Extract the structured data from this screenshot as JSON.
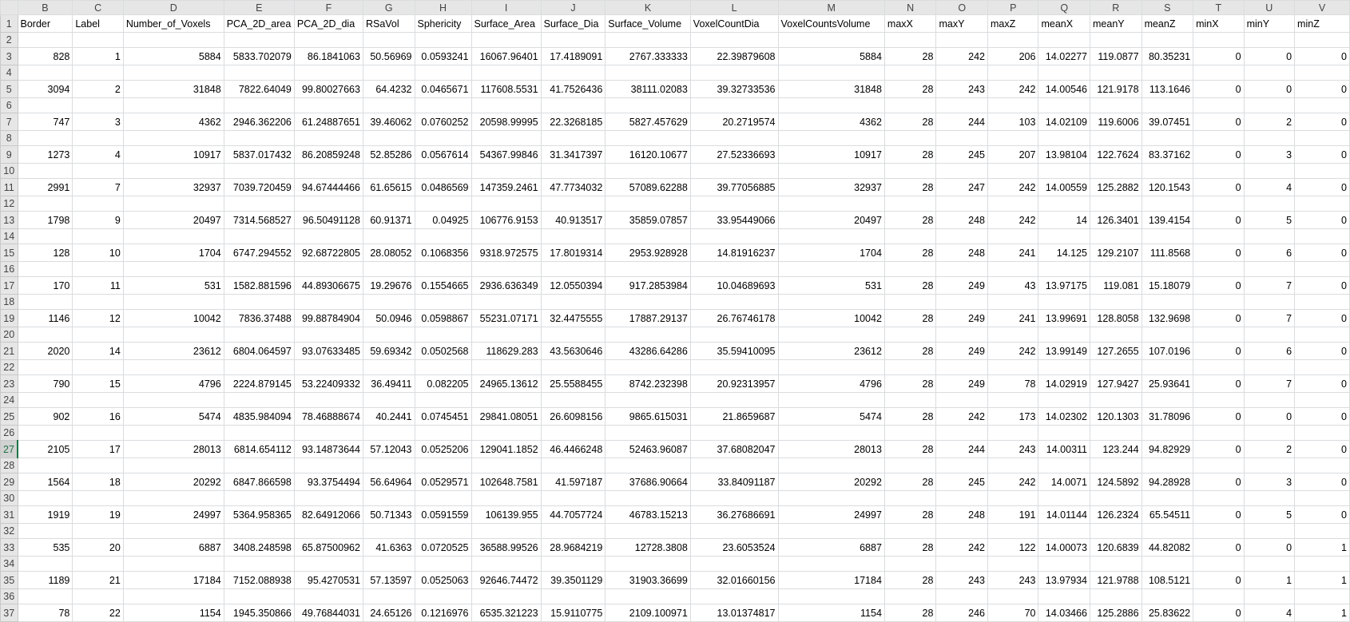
{
  "columns": [
    "B",
    "C",
    "D",
    "E",
    "F",
    "G",
    "H",
    "I",
    "J",
    "K",
    "L",
    "M",
    "N",
    "O",
    "P",
    "Q",
    "R",
    "S",
    "T",
    "U",
    "V"
  ],
  "header_row_num": "1",
  "headers": [
    "Border",
    "Label",
    "Number_of_Voxels",
    "PCA_2D_area",
    "PCA_2D_dia",
    "RSaVol",
    "Sphericity",
    "Surface_Area",
    "Surface_Dia",
    "Surface_Volume",
    "VoxelCountDia",
    "VoxelCountsVolume",
    "maxX",
    "maxY",
    "maxZ",
    "meanX",
    "meanY",
    "meanZ",
    "minX",
    "minY",
    "minZ"
  ],
  "active_row": "27",
  "rows": [
    {
      "num": "2",
      "cells": []
    },
    {
      "num": "3",
      "cells": [
        "828",
        "1",
        "5884",
        "5833.702079",
        "86.1841063",
        "50.56969",
        "0.0593241",
        "16067.96401",
        "17.4189091",
        "2767.333333",
        "22.39879608",
        "5884",
        "28",
        "242",
        "206",
        "14.02277",
        "119.0877",
        "80.35231",
        "0",
        "0",
        "0"
      ]
    },
    {
      "num": "4",
      "cells": []
    },
    {
      "num": "5",
      "cells": [
        "3094",
        "2",
        "31848",
        "7822.64049",
        "99.80027663",
        "64.4232",
        "0.0465671",
        "117608.5531",
        "41.7526436",
        "38111.02083",
        "39.32733536",
        "31848",
        "28",
        "243",
        "242",
        "14.00546",
        "121.9178",
        "113.1646",
        "0",
        "0",
        "0"
      ]
    },
    {
      "num": "6",
      "cells": []
    },
    {
      "num": "7",
      "cells": [
        "747",
        "3",
        "4362",
        "2946.362206",
        "61.24887651",
        "39.46062",
        "0.0760252",
        "20598.99995",
        "22.3268185",
        "5827.457629",
        "20.2719574",
        "4362",
        "28",
        "244",
        "103",
        "14.02109",
        "119.6006",
        "39.07451",
        "0",
        "2",
        "0"
      ]
    },
    {
      "num": "8",
      "cells": []
    },
    {
      "num": "9",
      "cells": [
        "1273",
        "4",
        "10917",
        "5837.017432",
        "86.20859248",
        "52.85286",
        "0.0567614",
        "54367.99846",
        "31.3417397",
        "16120.10677",
        "27.52336693",
        "10917",
        "28",
        "245",
        "207",
        "13.98104",
        "122.7624",
        "83.37162",
        "0",
        "3",
        "0"
      ]
    },
    {
      "num": "10",
      "cells": []
    },
    {
      "num": "11",
      "cells": [
        "2991",
        "7",
        "32937",
        "7039.720459",
        "94.67444466",
        "61.65615",
        "0.0486569",
        "147359.2461",
        "47.7734032",
        "57089.62288",
        "39.77056885",
        "32937",
        "28",
        "247",
        "242",
        "14.00559",
        "125.2882",
        "120.1543",
        "0",
        "4",
        "0"
      ]
    },
    {
      "num": "12",
      "cells": []
    },
    {
      "num": "13",
      "cells": [
        "1798",
        "9",
        "20497",
        "7314.568527",
        "96.50491128",
        "60.91371",
        "0.04925",
        "106776.9153",
        "40.913517",
        "35859.07857",
        "33.95449066",
        "20497",
        "28",
        "248",
        "242",
        "14",
        "126.3401",
        "139.4154",
        "0",
        "5",
        "0"
      ]
    },
    {
      "num": "14",
      "cells": []
    },
    {
      "num": "15",
      "cells": [
        "128",
        "10",
        "1704",
        "6747.294552",
        "92.68722805",
        "28.08052",
        "0.1068356",
        "9318.972575",
        "17.8019314",
        "2953.928928",
        "14.81916237",
        "1704",
        "28",
        "248",
        "241",
        "14.125",
        "129.2107",
        "111.8568",
        "0",
        "6",
        "0"
      ]
    },
    {
      "num": "16",
      "cells": []
    },
    {
      "num": "17",
      "cells": [
        "170",
        "11",
        "531",
        "1582.881596",
        "44.89306675",
        "19.29676",
        "0.1554665",
        "2936.636349",
        "12.0550394",
        "917.2853984",
        "10.04689693",
        "531",
        "28",
        "249",
        "43",
        "13.97175",
        "119.081",
        "15.18079",
        "0",
        "7",
        "0"
      ]
    },
    {
      "num": "18",
      "cells": []
    },
    {
      "num": "19",
      "cells": [
        "1146",
        "12",
        "10042",
        "7836.37488",
        "99.88784904",
        "50.0946",
        "0.0598867",
        "55231.07171",
        "32.4475555",
        "17887.29137",
        "26.76746178",
        "10042",
        "28",
        "249",
        "241",
        "13.99691",
        "128.8058",
        "132.9698",
        "0",
        "7",
        "0"
      ]
    },
    {
      "num": "20",
      "cells": []
    },
    {
      "num": "21",
      "cells": [
        "2020",
        "14",
        "23612",
        "6804.064597",
        "93.07633485",
        "59.69342",
        "0.0502568",
        "118629.283",
        "43.5630646",
        "43286.64286",
        "35.59410095",
        "23612",
        "28",
        "249",
        "242",
        "13.99149",
        "127.2655",
        "107.0196",
        "0",
        "6",
        "0"
      ]
    },
    {
      "num": "22",
      "cells": []
    },
    {
      "num": "23",
      "cells": [
        "790",
        "15",
        "4796",
        "2224.879145",
        "53.22409332",
        "36.49411",
        "0.082205",
        "24965.13612",
        "25.5588455",
        "8742.232398",
        "20.92313957",
        "4796",
        "28",
        "249",
        "78",
        "14.02919",
        "127.9427",
        "25.93641",
        "0",
        "7",
        "0"
      ]
    },
    {
      "num": "24",
      "cells": []
    },
    {
      "num": "25",
      "cells": [
        "902",
        "16",
        "5474",
        "4835.984094",
        "78.46888674",
        "40.2441",
        "0.0745451",
        "29841.08051",
        "26.6098156",
        "9865.615031",
        "21.8659687",
        "5474",
        "28",
        "242",
        "173",
        "14.02302",
        "120.1303",
        "31.78096",
        "0",
        "0",
        "0"
      ]
    },
    {
      "num": "26",
      "cells": []
    },
    {
      "num": "27",
      "cells": [
        "2105",
        "17",
        "28013",
        "6814.654112",
        "93.14873644",
        "57.12043",
        "0.0525206",
        "129041.1852",
        "46.4466248",
        "52463.96087",
        "37.68082047",
        "28013",
        "28",
        "244",
        "243",
        "14.00311",
        "123.244",
        "94.82929",
        "0",
        "2",
        "0"
      ]
    },
    {
      "num": "28",
      "cells": []
    },
    {
      "num": "29",
      "cells": [
        "1564",
        "18",
        "20292",
        "6847.866598",
        "93.3754494",
        "56.64964",
        "0.0529571",
        "102648.7581",
        "41.597187",
        "37686.90664",
        "33.84091187",
        "20292",
        "28",
        "245",
        "242",
        "14.0071",
        "124.5892",
        "94.28928",
        "0",
        "3",
        "0"
      ]
    },
    {
      "num": "30",
      "cells": []
    },
    {
      "num": "31",
      "cells": [
        "1919",
        "19",
        "24997",
        "5364.958365",
        "82.64912066",
        "50.71343",
        "0.0591559",
        "106139.955",
        "44.7057724",
        "46783.15213",
        "36.27686691",
        "24997",
        "28",
        "248",
        "191",
        "14.01144",
        "126.2324",
        "65.54511",
        "0",
        "5",
        "0"
      ]
    },
    {
      "num": "32",
      "cells": []
    },
    {
      "num": "33",
      "cells": [
        "535",
        "20",
        "6887",
        "3408.248598",
        "65.87500962",
        "41.6363",
        "0.0720525",
        "36588.99526",
        "28.9684219",
        "12728.3808",
        "23.6053524",
        "6887",
        "28",
        "242",
        "122",
        "14.00073",
        "120.6839",
        "44.82082",
        "0",
        "0",
        "1"
      ]
    },
    {
      "num": "34",
      "cells": []
    },
    {
      "num": "35",
      "cells": [
        "1189",
        "21",
        "17184",
        "7152.088938",
        "95.4270531",
        "57.13597",
        "0.0525063",
        "92646.74472",
        "39.3501129",
        "31903.36699",
        "32.01660156",
        "17184",
        "28",
        "243",
        "243",
        "13.97934",
        "121.9788",
        "108.5121",
        "0",
        "1",
        "1"
      ]
    },
    {
      "num": "36",
      "cells": []
    },
    {
      "num": "37",
      "cells": [
        "78",
        "22",
        "1154",
        "1945.350866",
        "49.76844031",
        "24.65126",
        "0.1216976",
        "6535.321223",
        "15.9110775",
        "2109.100971",
        "13.01374817",
        "1154",
        "28",
        "246",
        "70",
        "14.03466",
        "125.2886",
        "25.83622",
        "0",
        "4",
        "1"
      ]
    }
  ]
}
